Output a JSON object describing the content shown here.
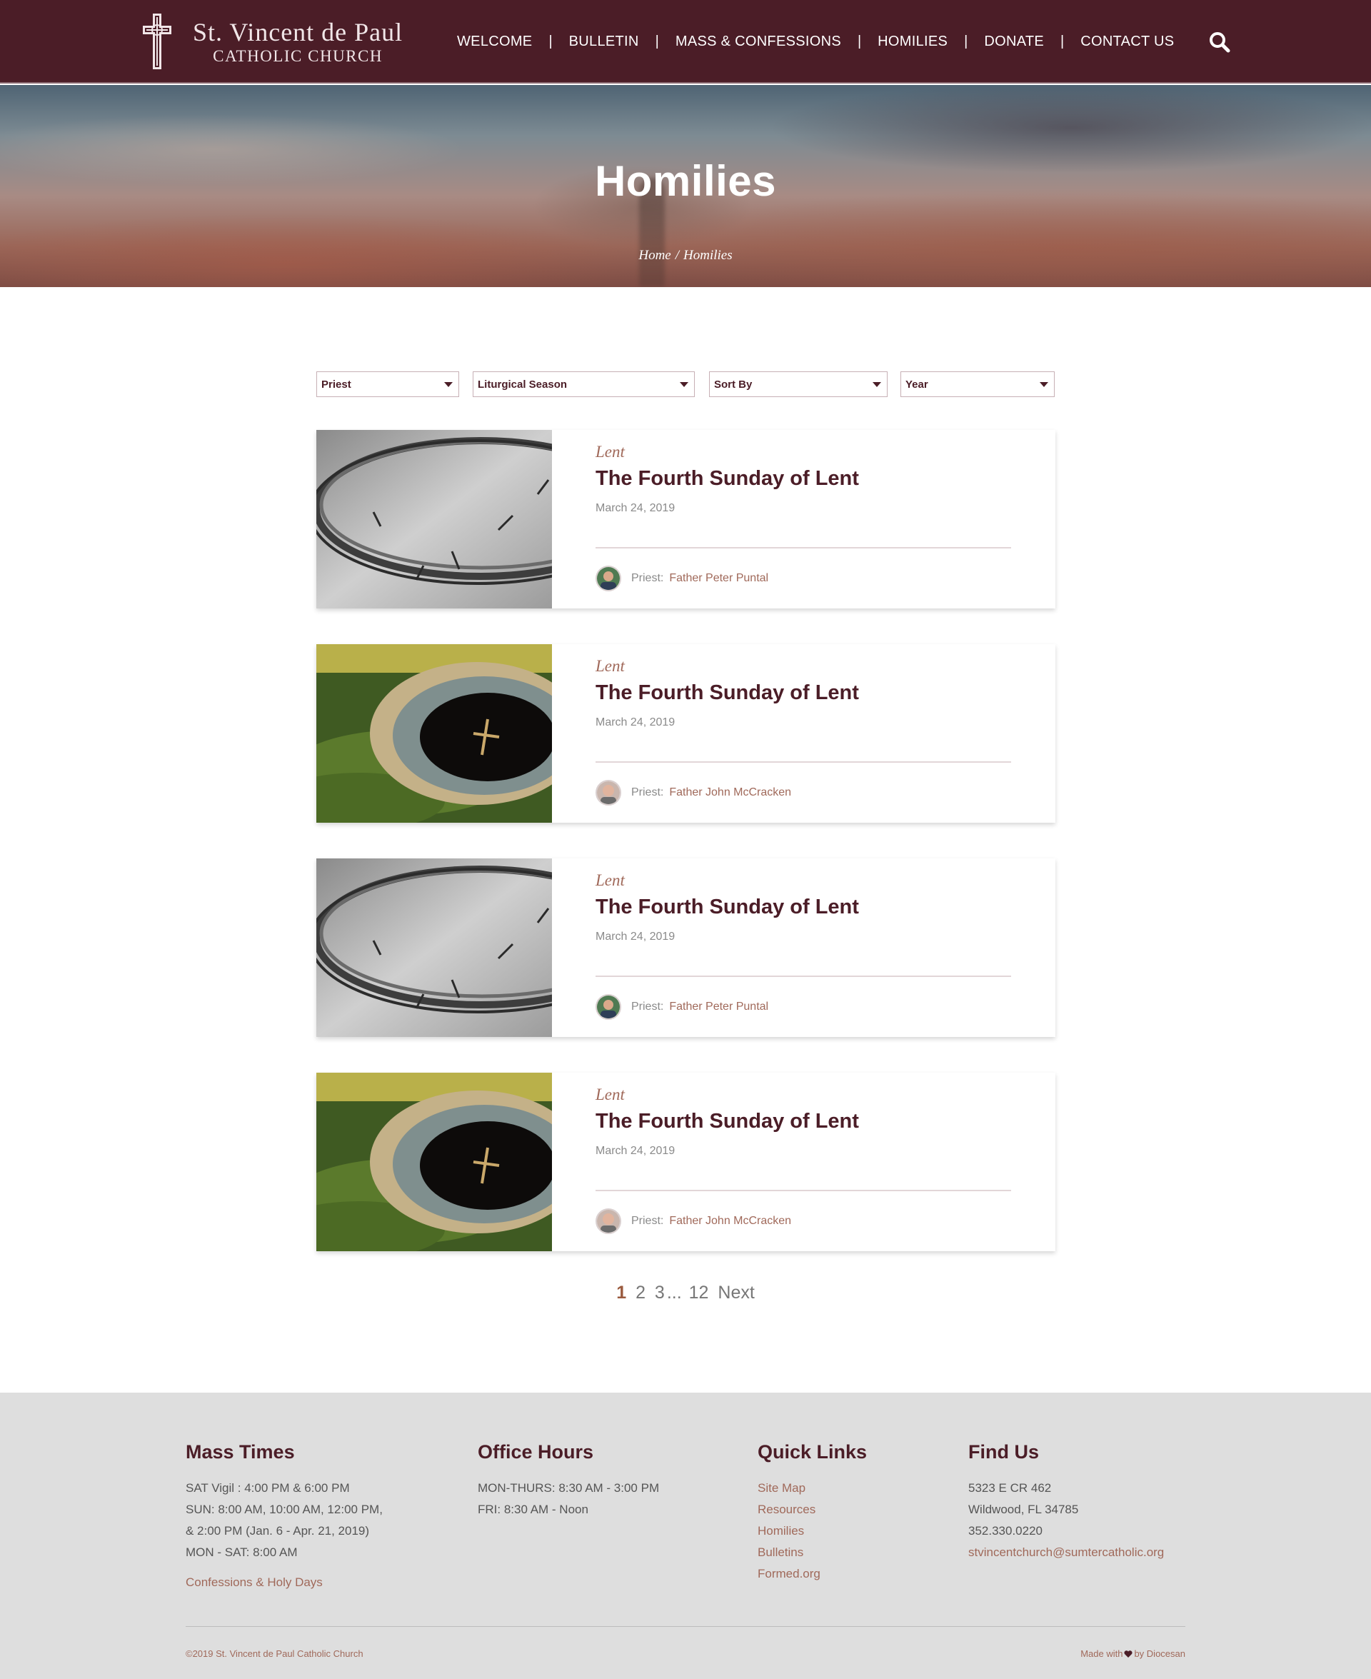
{
  "brand": {
    "line1": "St. Vincent de Paul",
    "line2": "CATHOLIC CHURCH"
  },
  "nav": {
    "items": [
      {
        "label": "WELCOME"
      },
      {
        "label": "BULLETIN"
      },
      {
        "label": "MASS & CONFESSIONS"
      },
      {
        "label": "HOMILIES"
      },
      {
        "label": "DONATE"
      },
      {
        "label": "CONTACT US"
      }
    ],
    "separator": "|",
    "search_icon": "search-icon"
  },
  "hero": {
    "title": "Homilies",
    "breadcrumb": {
      "home": "Home",
      "separator": "/",
      "current": "Homilies"
    }
  },
  "filters": [
    {
      "label": "Priest"
    },
    {
      "label": "Liturgical Season"
    },
    {
      "label": "Sort By"
    },
    {
      "label": "Year"
    }
  ],
  "homilies": [
    {
      "season": "Lent",
      "title": "The Fourth Sunday of Lent",
      "date": "March 24, 2019",
      "priest_label": "Priest:",
      "priest": "Father Peter Puntal",
      "image": "crown-of-thorns"
    },
    {
      "season": "Lent",
      "title": "The Fourth Sunday of Lent",
      "date": "March 24, 2019",
      "priest_label": "Priest:",
      "priest": "Father John McCracken",
      "image": "ash-bowl-with-cross"
    },
    {
      "season": "Lent",
      "title": "The Fourth Sunday of Lent",
      "date": "March 24, 2019",
      "priest_label": "Priest:",
      "priest": "Father Peter Puntal",
      "image": "crown-of-thorns"
    },
    {
      "season": "Lent",
      "title": "The Fourth Sunday of Lent",
      "date": "March 24, 2019",
      "priest_label": "Priest:",
      "priest": "Father John McCracken",
      "image": "ash-bowl-with-cross"
    }
  ],
  "pagination": {
    "current": "1",
    "pages": [
      "2",
      "3"
    ],
    "ellipsis": "...",
    "last": "12",
    "next": "Next"
  },
  "footer": {
    "mass_times": {
      "heading": "Mass Times",
      "lines": [
        "SAT Vigil : 4:00 PM & 6:00 PM",
        "SUN: 8:00 AM, 10:00 AM, 12:00 PM,",
        "& 2:00 PM (Jan. 6 - Apr. 21, 2019)",
        "MON - SAT: 8:00 AM"
      ],
      "link": "Confessions & Holy Days"
    },
    "office_hours": {
      "heading": "Office Hours",
      "lines": [
        "MON-THURS: 8:30 AM - 3:00 PM",
        "FRI: 8:30 AM - Noon"
      ]
    },
    "quick_links": {
      "heading": "Quick Links",
      "links": [
        "Site Map",
        "Resources",
        "Homilies",
        "Bulletins",
        "Formed.org"
      ]
    },
    "find_us": {
      "heading": "Find Us",
      "lines": [
        "5323 E CR 462",
        "Wildwood, FL 34785",
        "352.330.0220"
      ],
      "email": "stvincentchurch@sumtercatholic.org"
    },
    "copyright": "©2019 St. Vincent de Paul Catholic Church",
    "made_with": "Made with",
    "made_by": "by Diocesan"
  },
  "colors": {
    "brand": "#4b1d27",
    "accent": "#a0695a",
    "footer_bg": "#dedede"
  }
}
